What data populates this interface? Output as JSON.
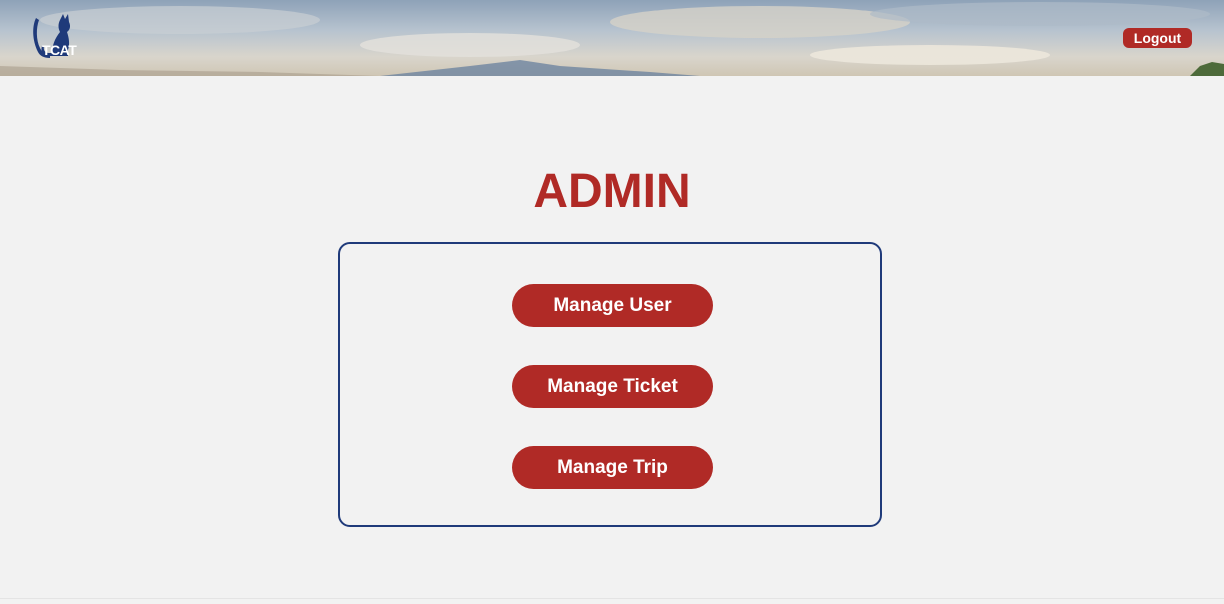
{
  "header": {
    "logo_text": "TCAT",
    "logout_label": "Logout"
  },
  "main": {
    "title": "ADMIN",
    "buttons": [
      {
        "label": "Manage User"
      },
      {
        "label": "Manage Ticket"
      },
      {
        "label": "Manage Trip"
      }
    ]
  },
  "colors": {
    "accent": "#b02a26",
    "border": "#1f3a7a",
    "background": "#f2f2f2"
  },
  "icons": {
    "logo": "cat-icon"
  }
}
